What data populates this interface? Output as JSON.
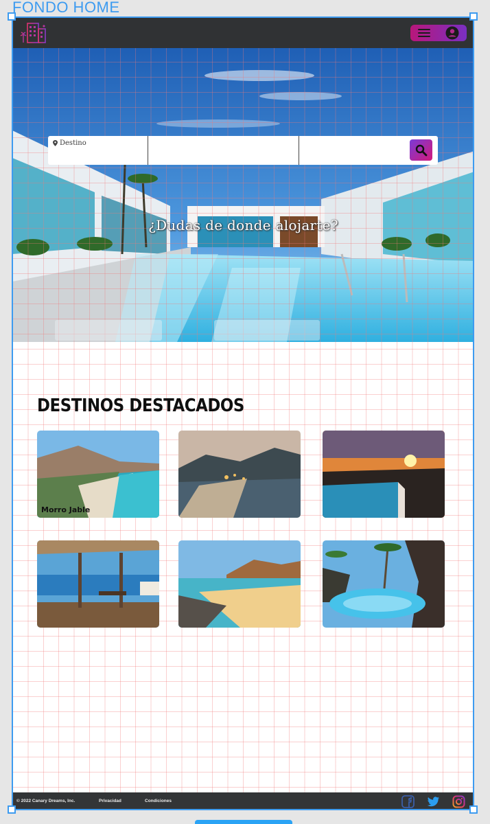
{
  "canvas": {
    "frame_label": "FONDO HOME"
  },
  "header": {
    "menu_icon": "hamburger-icon",
    "user_icon": "account-circle-icon",
    "accent_start": "#b8177a",
    "accent_end": "#7a2fc2"
  },
  "search": {
    "destination_label": "Destino",
    "pin_icon": "map-pin-icon",
    "search_icon": "magnifier-icon"
  },
  "hero": {
    "title": "¿Dudas de donde alojarte?"
  },
  "featured": {
    "title": "DESTINOS DESTACADOS",
    "cards": [
      {
        "label": "Morro Jable",
        "scene": "coastal-town"
      },
      {
        "label": "",
        "scene": "night-coast"
      },
      {
        "label": "",
        "scene": "sunset-pool"
      },
      {
        "label": "",
        "scene": "terrace"
      },
      {
        "label": "",
        "scene": "golden-beach"
      },
      {
        "label": "",
        "scene": "lagoon-pool"
      }
    ]
  },
  "footer": {
    "copyright": "© 2022 Canary Dreams, Inc.",
    "privacy": "Privacidad",
    "terms": "Condiciones",
    "social": [
      "facebook-icon",
      "twitter-icon",
      "instagram-icon"
    ]
  }
}
